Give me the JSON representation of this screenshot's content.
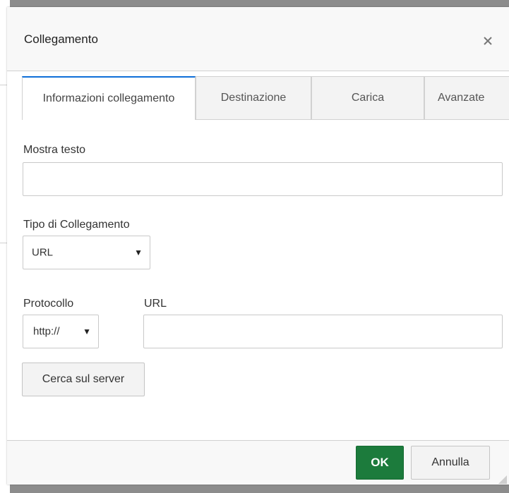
{
  "dialog": {
    "title": "Collegamento",
    "close_icon": "close-icon"
  },
  "tabs": [
    {
      "label": "Informazioni collegamento",
      "active": true
    },
    {
      "label": "Destinazione",
      "active": false
    },
    {
      "label": "Carica",
      "active": false
    },
    {
      "label": "Avanzate",
      "active": false
    }
  ],
  "display_text": {
    "label": "Mostra testo",
    "value": ""
  },
  "link_type": {
    "label": "Tipo di Collegamento",
    "selected": "URL",
    "arrow": "▼"
  },
  "protocol": {
    "label": "Protocollo",
    "selected": "http://",
    "arrow": "▼"
  },
  "url": {
    "label": "URL",
    "value": ""
  },
  "browse_button": {
    "label": "Cerca sul server"
  },
  "footer": {
    "ok_label": "OK",
    "cancel_label": "Annulla"
  },
  "colors": {
    "accent_tab": "#0e6ed8",
    "ok_button": "#1c7b3c"
  }
}
